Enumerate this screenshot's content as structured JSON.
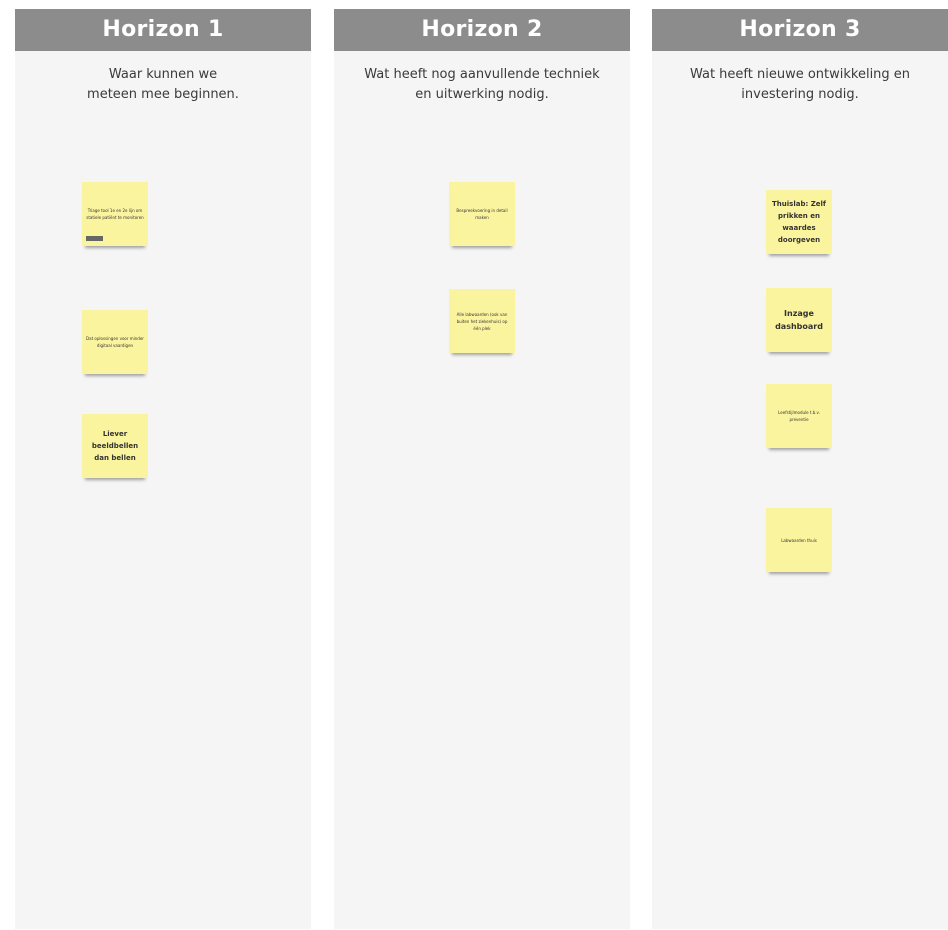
{
  "columns": [
    {
      "title": "Horizon 1",
      "subtitle_line1": "Waar kunnen we",
      "subtitle_line2": "meteen mee beginnen.",
      "notes": [
        "Triage tool 1e en 2e lijn om statiele patiënt te monitoren",
        "Dat oplossingen voor minder digitaal vaardigen",
        "Liever beeldbellen dan bellen"
      ]
    },
    {
      "title": "Horizon 2",
      "subtitle_line1": "Wat heeft nog aanvullende techniek",
      "subtitle_line2": "en uitwerking nodig.",
      "notes": [
        "Bespreekvoering in detail maken",
        "Alle labwaarden (ook van buiten het ziekenhuis) op één plek"
      ]
    },
    {
      "title": "Horizon 3",
      "subtitle_line1": "Wat heeft nieuwe ontwikkeling en",
      "subtitle_line2": "investering nodig.",
      "notes": [
        "Thuislab: Zelf prikken en waardes doorgeven",
        "Inzage dashboard",
        "Leefstijlmodule t.b.v. preventie",
        "Labwaarden thuis"
      ]
    }
  ]
}
